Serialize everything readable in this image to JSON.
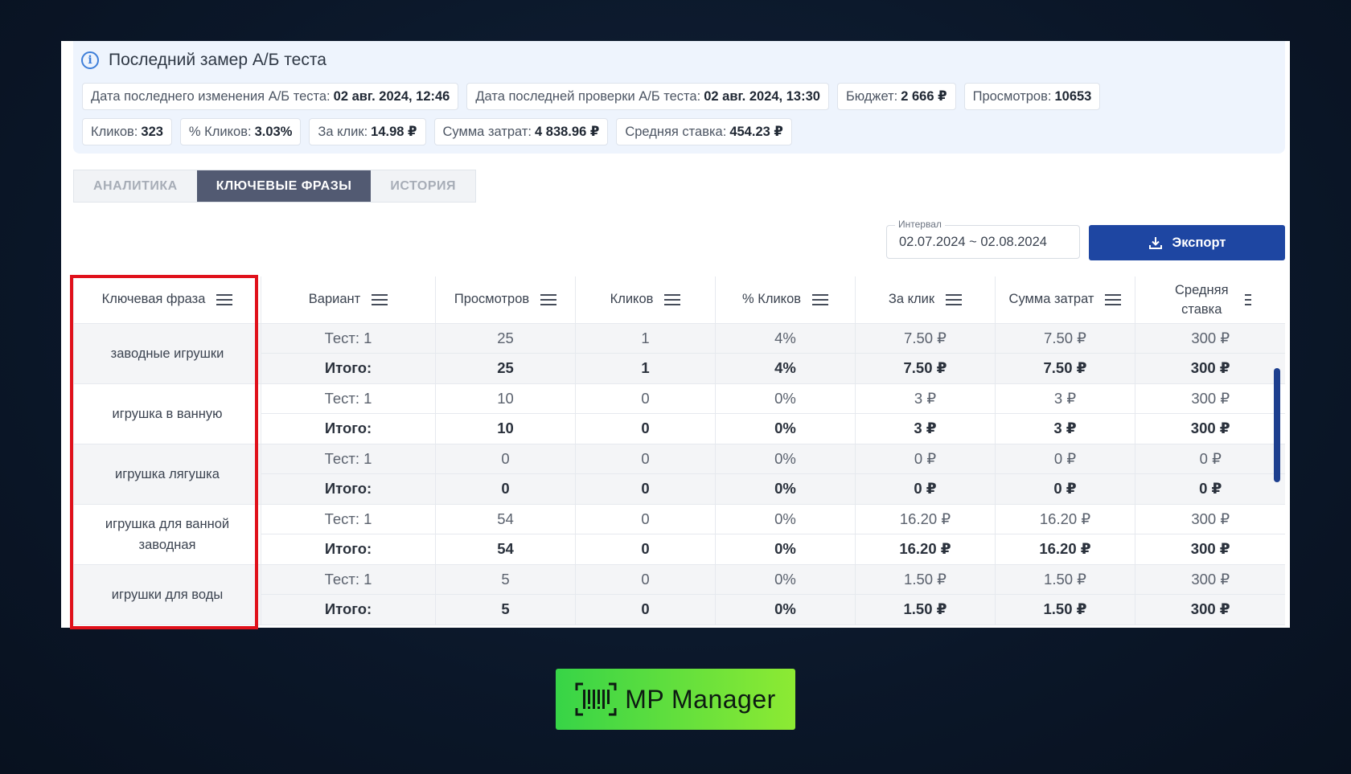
{
  "info": {
    "title": "Последний замер А/Б теста",
    "chips_row1": [
      {
        "label": "Дата последнего изменения А/Б теста:",
        "value": "02 авг. 2024, 12:46"
      },
      {
        "label": "Дата последней проверки А/Б теста:",
        "value": "02 авг. 2024, 13:30"
      },
      {
        "label": "Бюджет:",
        "value": "2 666 ₽"
      },
      {
        "label": "Просмотров:",
        "value": "10653"
      }
    ],
    "chips_row2": [
      {
        "label": "Кликов:",
        "value": "323"
      },
      {
        "label": "% Кликов:",
        "value": "3.03%"
      },
      {
        "label": "За клик:",
        "value": "14.98 ₽"
      },
      {
        "label": "Сумма затрат:",
        "value": "4 838.96 ₽"
      },
      {
        "label": "Средняя ставка:",
        "value": "454.23 ₽"
      }
    ]
  },
  "tabs": [
    {
      "label": "АНАЛИТИКА",
      "active": false
    },
    {
      "label": "КЛЮЧЕВЫЕ ФРАЗЫ",
      "active": true
    },
    {
      "label": "ИСТОРИЯ",
      "active": false
    }
  ],
  "interval": {
    "label": "Интервал",
    "value": "02.07.2024 ~ 02.08.2024"
  },
  "export_label": "Экспорт",
  "table": {
    "columns": [
      "Ключевая фраза",
      "Вариант",
      "Просмотров",
      "Кликов",
      "% Кликов",
      "За клик",
      "Сумма затрат",
      "Средняя ставка"
    ],
    "groups": [
      {
        "phrase": "заводные игрушки",
        "rows": [
          [
            "Тест: 1",
            "25",
            "1",
            "4%",
            "7.50 ₽",
            "7.50 ₽",
            "300 ₽"
          ],
          [
            "Итого:",
            "25",
            "1",
            "4%",
            "7.50 ₽",
            "7.50 ₽",
            "300 ₽"
          ]
        ]
      },
      {
        "phrase": "игрушка в ванную",
        "rows": [
          [
            "Тест: 1",
            "10",
            "0",
            "0%",
            "3 ₽",
            "3 ₽",
            "300 ₽"
          ],
          [
            "Итого:",
            "10",
            "0",
            "0%",
            "3 ₽",
            "3 ₽",
            "300 ₽"
          ]
        ]
      },
      {
        "phrase": "игрушка лягушка",
        "rows": [
          [
            "Тест: 1",
            "0",
            "0",
            "0%",
            "0 ₽",
            "0 ₽",
            "0 ₽"
          ],
          [
            "Итого:",
            "0",
            "0",
            "0%",
            "0 ₽",
            "0 ₽",
            "0 ₽"
          ]
        ]
      },
      {
        "phrase": "игрушка для ванной заводная",
        "rows": [
          [
            "Тест: 1",
            "54",
            "0",
            "0%",
            "16.20 ₽",
            "16.20 ₽",
            "300 ₽"
          ],
          [
            "Итого:",
            "54",
            "0",
            "0%",
            "16.20 ₽",
            "16.20 ₽",
            "300 ₽"
          ]
        ]
      },
      {
        "phrase": "игрушки для воды",
        "rows": [
          [
            "Тест: 1",
            "5",
            "0",
            "0%",
            "1.50 ₽",
            "1.50 ₽",
            "300 ₽"
          ],
          [
            "Итого:",
            "5",
            "0",
            "0%",
            "1.50 ₽",
            "1.50 ₽",
            "300 ₽"
          ]
        ]
      }
    ]
  },
  "logo_text": "MP Manager",
  "colors": {
    "accent": "#1e46a2",
    "tab_active": "#525a72",
    "highlight": "#e0111b",
    "logo_green": "#4ddb3f"
  }
}
